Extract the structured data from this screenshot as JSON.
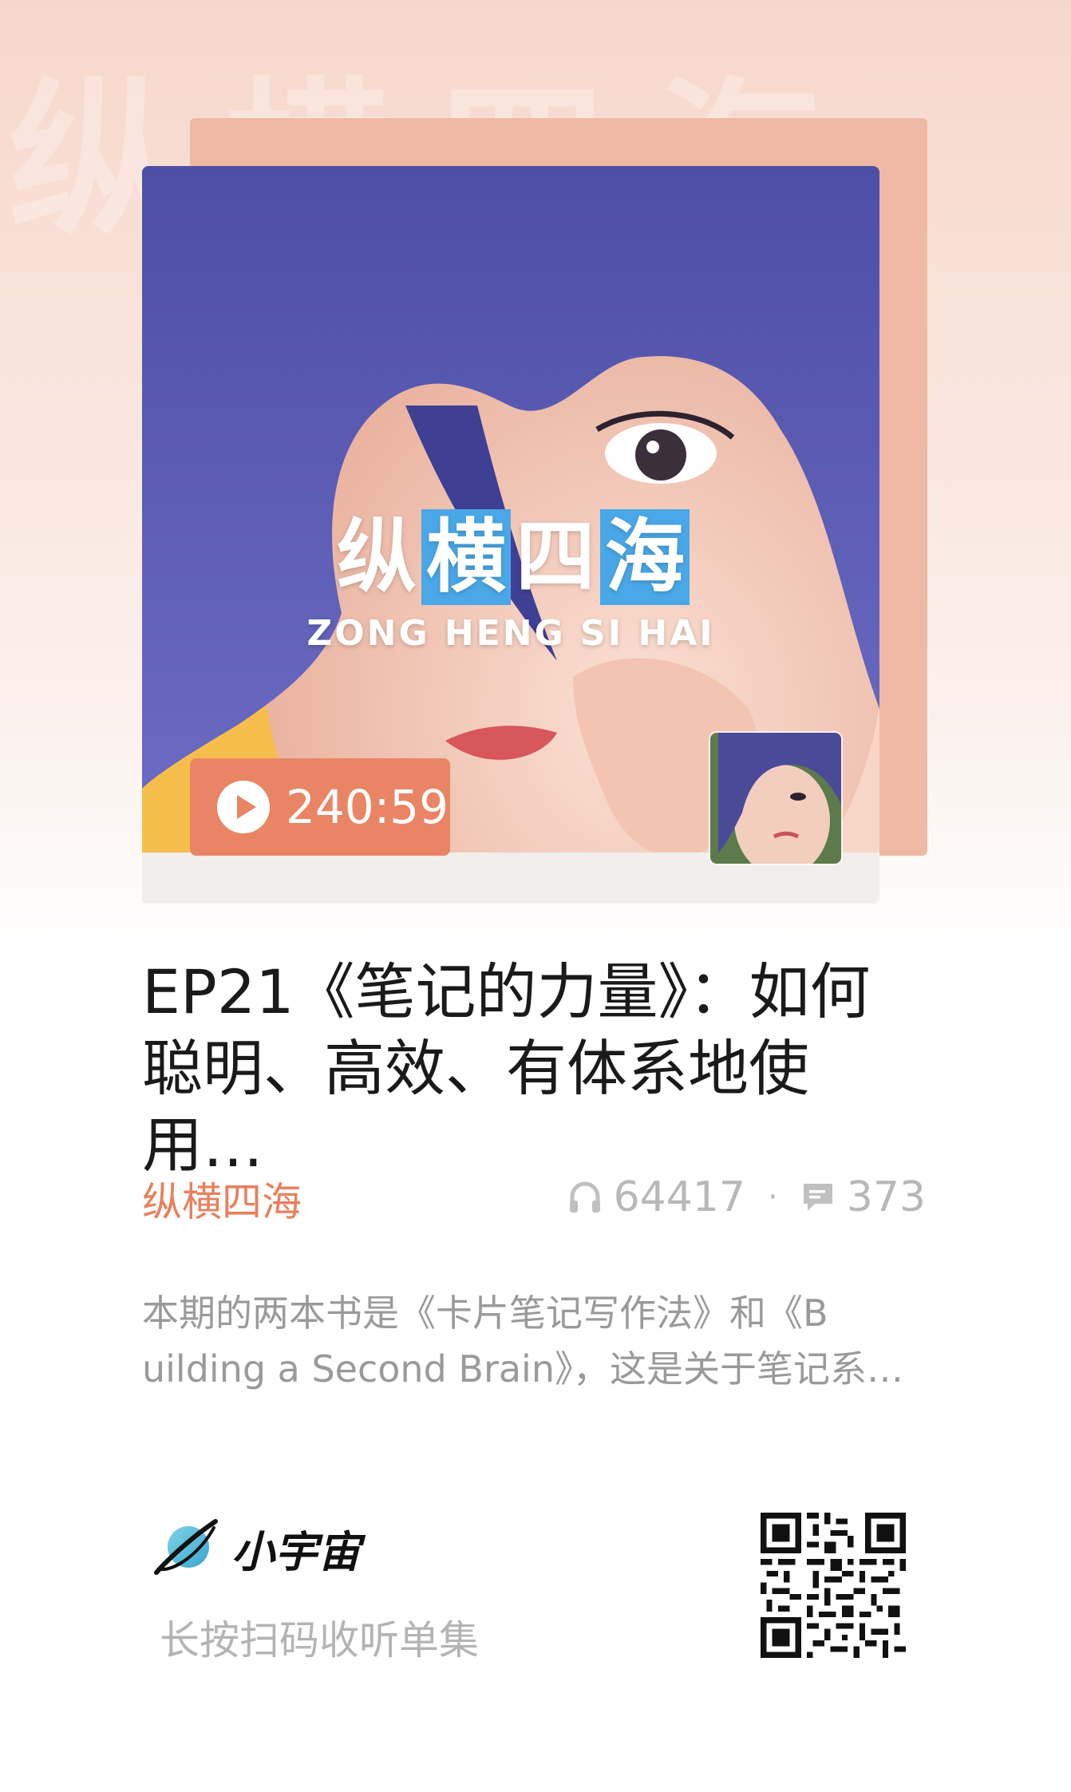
{
  "background_watermark": "纵横四海",
  "cover": {
    "show_title_chars": [
      "纵",
      "横",
      "四",
      "海"
    ],
    "show_title_highlighted": [
      false,
      true,
      false,
      true
    ],
    "show_subtitle": "ZONG HENG SI HAI",
    "duration": "240:59",
    "colors": {
      "hair": "#5a5ab0",
      "accent_yellow": "#f5bd4c",
      "pill": "#e98564",
      "highlight_blue": "#4aa8e8"
    }
  },
  "episode": {
    "title_line1": "EP21《笔记的力量》：如何",
    "title_line2": "聪明、高效、有体系地使用…",
    "podcast_name": "纵横四海",
    "play_count": "64417",
    "comment_count": "373",
    "description_line1": "本期的两本书是《卡片笔记写作法》和《B",
    "description_line2": "uilding a Second Brain》，这是关于笔记系…"
  },
  "footer": {
    "brand_name": "小宇宙",
    "scan_hint": "长按扫码收听单集",
    "icons": {
      "brand": "planet-logo-icon",
      "qr": "qr-code-icon",
      "plays": "headphones-icon",
      "comments": "comment-icon"
    }
  }
}
